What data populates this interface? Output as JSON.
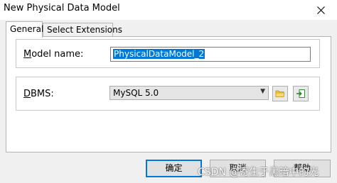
{
  "window": {
    "title": "New Physical Data Model"
  },
  "tabs": [
    {
      "label": "General",
      "active": true
    },
    {
      "label": "Select Extensions",
      "active": false
    }
  ],
  "model_name": {
    "label_mnemonic": "M",
    "label_rest": "odel name:",
    "value": "PhysicalDataModel_2"
  },
  "dbms": {
    "label_mnemonic": "D",
    "label_rest": "BMS:",
    "selected": "MySQL 5.0"
  },
  "buttons": {
    "ok": "确定",
    "cancel": "取消",
    "help": "帮助"
  },
  "watermark": "CSDN @寄生于黑暗中的光",
  "icons": {
    "close": "close-icon",
    "browse": "folder-icon",
    "import": "import-icon"
  },
  "colors": {
    "selection": "#0078d7",
    "default_button_border": "#0078d7"
  }
}
